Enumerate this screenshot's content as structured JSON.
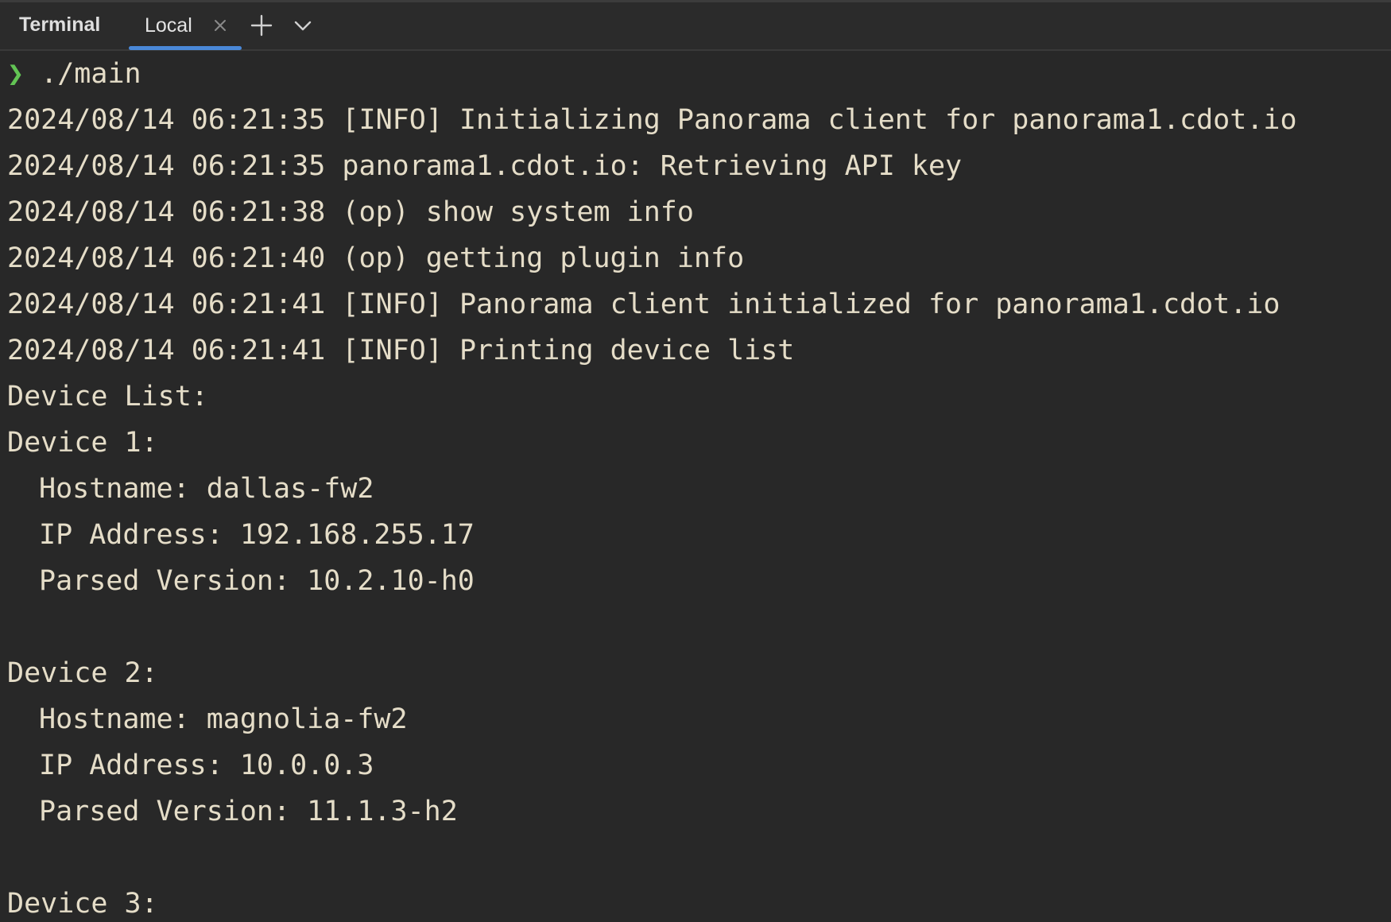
{
  "tool_window": {
    "title": "Terminal",
    "tabs": [
      {
        "label": "Local",
        "active": true
      }
    ]
  },
  "icons": {
    "close": "close-icon",
    "add": "plus-icon",
    "dropdown": "chevron-down-icon"
  },
  "colors": {
    "background": "#282828",
    "text": "#e5ddc8",
    "prompt": "#62c454",
    "active_tab_underline": "#4a88d8"
  },
  "terminal": {
    "prompt_symbol": "❯",
    "command": "./main",
    "output": [
      "2024/08/14 06:21:35 [INFO] Initializing Panorama client for panorama1.cdot.io",
      "2024/08/14 06:21:35 panorama1.cdot.io: Retrieving API key",
      "2024/08/14 06:21:38 (op) show system info",
      "2024/08/14 06:21:40 (op) getting plugin info",
      "2024/08/14 06:21:41 [INFO] Panorama client initialized for panorama1.cdot.io",
      "2024/08/14 06:21:41 [INFO] Printing device list",
      "Device List:",
      "Device 1:",
      "Hostname: dallas-fw2",
      "IP Address: 192.168.255.17",
      "Parsed Version: 10.2.10-h0",
      "",
      "Device 2:",
      "Hostname: magnolia-fw2",
      "IP Address: 10.0.0.3",
      "Parsed Version: 11.1.3-h2",
      "",
      "Device 3:"
    ]
  }
}
